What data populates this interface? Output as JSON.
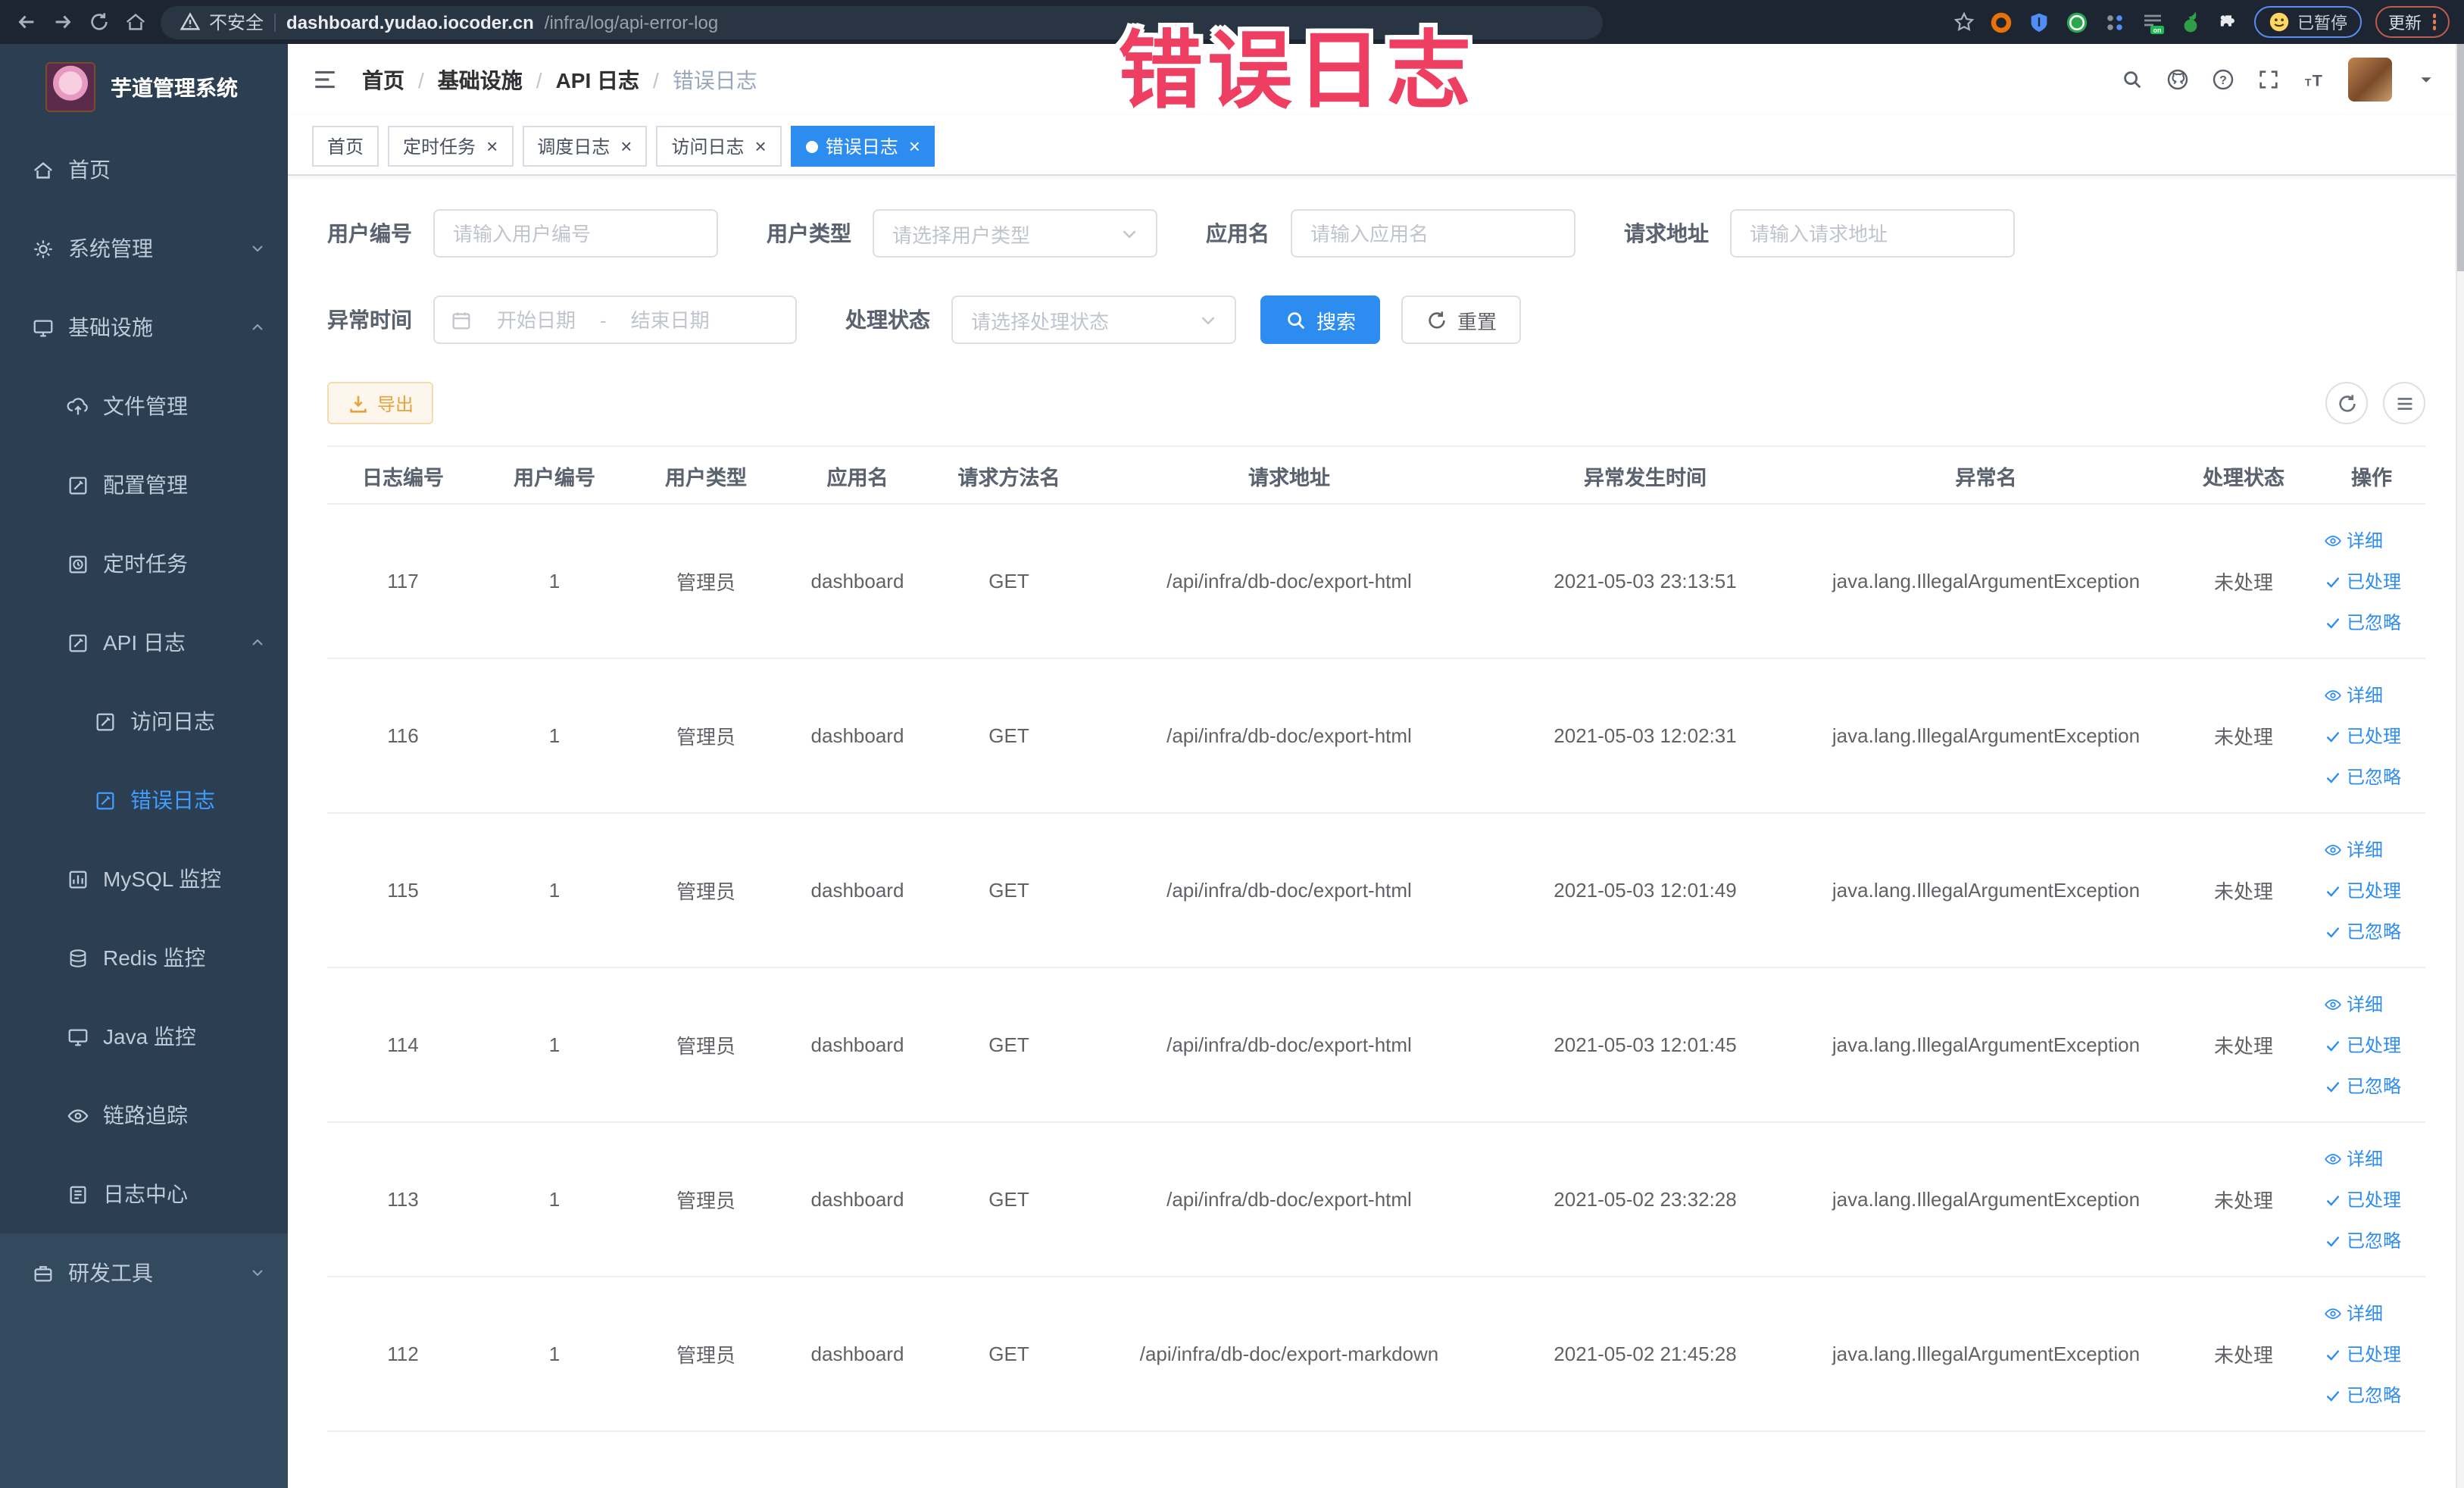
{
  "theme": {
    "primary": "#2d8cf0",
    "warning": "#e6a23c",
    "overlay_pink": "#ee3f63",
    "sidebar_dark": "#2b3e52",
    "sidebar_light": "#33495e",
    "active_menu": "#409eff"
  },
  "browser": {
    "security_label": "不安全",
    "host": "dashboard.yudao.iocoder.cn",
    "path": "/infra/log/api-error-log",
    "paused_label": "已暂停",
    "update_label": "更新",
    "extensions": [
      "donut",
      "shield",
      "greencircle",
      "dotgrid",
      "onbadge",
      "sprout",
      "puzzle"
    ]
  },
  "overlay": {
    "text": "错误日志"
  },
  "sidebar": {
    "title": "芋道管理系统",
    "items": [
      {
        "name": "home",
        "icon": "home",
        "label": "首页",
        "level": 1
      },
      {
        "name": "system",
        "icon": "gear",
        "label": "系统管理",
        "level": 1,
        "chevron": "down"
      },
      {
        "name": "infra",
        "icon": "monitor",
        "label": "基础设施",
        "level": 1,
        "chevron": "up"
      },
      {
        "name": "file-manage",
        "icon": "upload",
        "label": "文件管理",
        "level": 2
      },
      {
        "name": "config-manage",
        "icon": "edit",
        "label": "配置管理",
        "level": 2
      },
      {
        "name": "scheduled-job",
        "icon": "timer",
        "label": "定时任务",
        "level": 2
      },
      {
        "name": "api-log",
        "icon": "edit",
        "label": "API 日志",
        "level": 2,
        "chevron": "up"
      },
      {
        "name": "access-log",
        "icon": "edit",
        "label": "访问日志",
        "level": 3
      },
      {
        "name": "error-log",
        "icon": "edit",
        "label": "错误日志",
        "level": 3,
        "active": true
      },
      {
        "name": "mysql-monitor",
        "icon": "chart",
        "label": "MySQL 监控",
        "level": 2
      },
      {
        "name": "redis-monitor",
        "icon": "db",
        "label": "Redis 监控",
        "level": 2
      },
      {
        "name": "java-monitor",
        "icon": "monitor",
        "label": "Java 监控",
        "level": 2
      },
      {
        "name": "trace",
        "icon": "eye",
        "label": "链路追踪",
        "level": 2
      },
      {
        "name": "log-center",
        "icon": "doc",
        "label": "日志中心",
        "level": 2
      },
      {
        "name": "devtools",
        "icon": "toolbox",
        "label": "研发工具",
        "level": 1,
        "chevron": "down",
        "section": "light"
      }
    ]
  },
  "header": {
    "breadcrumb": [
      "首页",
      "基础设施",
      "API 日志",
      "错误日志"
    ]
  },
  "tabs": [
    {
      "label": "首页",
      "closable": false,
      "active": false
    },
    {
      "label": "定时任务",
      "closable": true,
      "active": false
    },
    {
      "label": "调度日志",
      "closable": true,
      "active": false
    },
    {
      "label": "访问日志",
      "closable": true,
      "active": false
    },
    {
      "label": "错误日志",
      "closable": true,
      "active": true
    }
  ],
  "filters": {
    "user_id": {
      "label": "用户编号",
      "placeholder": "请输入用户编号"
    },
    "user_type": {
      "label": "用户类型",
      "placeholder": "请选择用户类型"
    },
    "app_name": {
      "label": "应用名",
      "placeholder": "请输入应用名"
    },
    "request_url": {
      "label": "请求地址",
      "placeholder": "请输入请求地址"
    },
    "error_time": {
      "label": "异常时间",
      "start_placeholder": "开始日期",
      "range_separator": "-",
      "end_placeholder": "结束日期"
    },
    "process_status": {
      "label": "处理状态",
      "placeholder": "请选择处理状态"
    },
    "search_label": "搜索",
    "reset_label": "重置"
  },
  "toolbar": {
    "export_label": "导出"
  },
  "table": {
    "columns": [
      {
        "key": "id",
        "label": "日志编号"
      },
      {
        "key": "user_id",
        "label": "用户编号"
      },
      {
        "key": "user_type",
        "label": "用户类型"
      },
      {
        "key": "app",
        "label": "应用名"
      },
      {
        "key": "method",
        "label": "请求方法名"
      },
      {
        "key": "url",
        "label": "请求地址"
      },
      {
        "key": "time",
        "label": "异常发生时间"
      },
      {
        "key": "exception",
        "label": "异常名"
      },
      {
        "key": "status",
        "label": "处理状态"
      },
      {
        "key": "actions",
        "label": "操作"
      }
    ],
    "actions": [
      {
        "label": "详细",
        "icon": "eye"
      },
      {
        "label": "已处理",
        "icon": "check"
      },
      {
        "label": "已忽略",
        "icon": "check"
      }
    ],
    "rows": [
      {
        "id": "117",
        "user_id": "1",
        "user_type": "管理员",
        "app": "dashboard",
        "method": "GET",
        "url": "/api/infra/db-doc/export-html",
        "time": "2021-05-03 23:13:51",
        "exception": "java.lang.IllegalArgumentException",
        "status": "未处理"
      },
      {
        "id": "116",
        "user_id": "1",
        "user_type": "管理员",
        "app": "dashboard",
        "method": "GET",
        "url": "/api/infra/db-doc/export-html",
        "time": "2021-05-03 12:02:31",
        "exception": "java.lang.IllegalArgumentException",
        "status": "未处理"
      },
      {
        "id": "115",
        "user_id": "1",
        "user_type": "管理员",
        "app": "dashboard",
        "method": "GET",
        "url": "/api/infra/db-doc/export-html",
        "time": "2021-05-03 12:01:49",
        "exception": "java.lang.IllegalArgumentException",
        "status": "未处理"
      },
      {
        "id": "114",
        "user_id": "1",
        "user_type": "管理员",
        "app": "dashboard",
        "method": "GET",
        "url": "/api/infra/db-doc/export-html",
        "time": "2021-05-03 12:01:45",
        "exception": "java.lang.IllegalArgumentException",
        "status": "未处理"
      },
      {
        "id": "113",
        "user_id": "1",
        "user_type": "管理员",
        "app": "dashboard",
        "method": "GET",
        "url": "/api/infra/db-doc/export-html",
        "time": "2021-05-02 23:32:28",
        "exception": "java.lang.IllegalArgumentException",
        "status": "未处理"
      },
      {
        "id": "112",
        "user_id": "1",
        "user_type": "管理员",
        "app": "dashboard",
        "method": "GET",
        "url": "/api/infra/db-doc/export-markdown",
        "time": "2021-05-02 21:45:28",
        "exception": "java.lang.IllegalArgumentException",
        "status": "未处理"
      }
    ]
  }
}
